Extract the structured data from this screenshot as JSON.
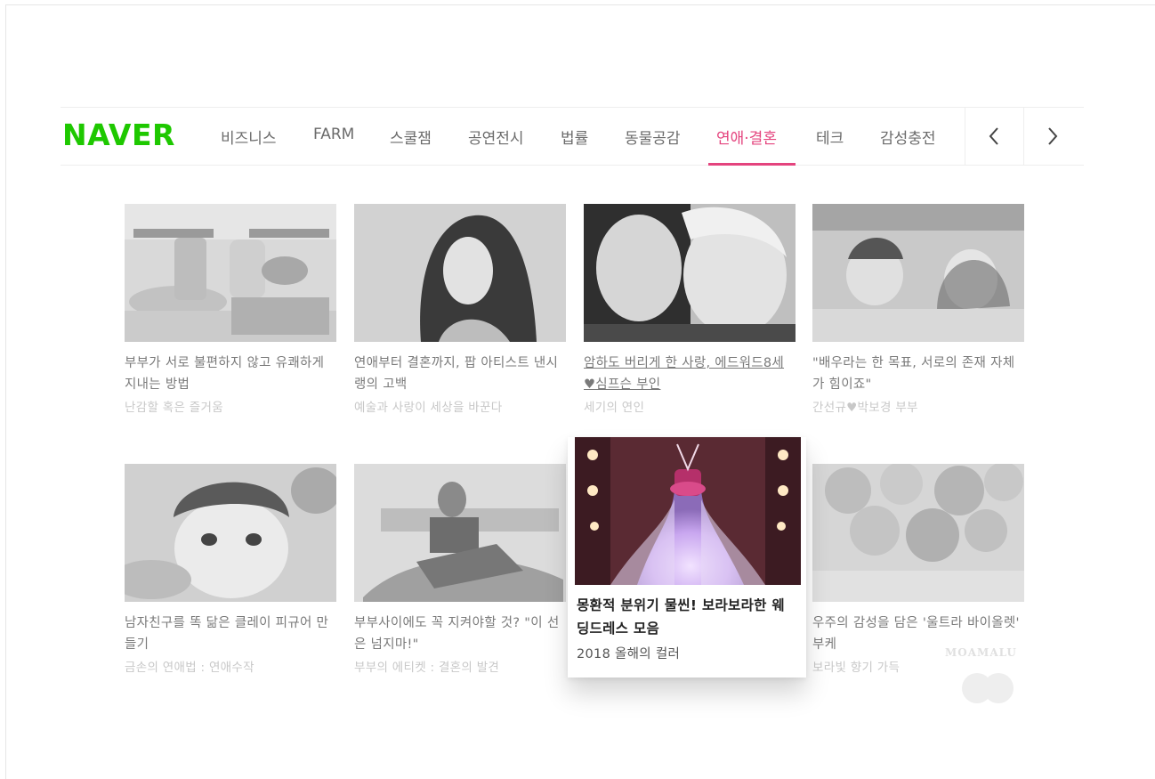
{
  "brand": {
    "logo": "NAVER",
    "color": "#1ec800",
    "accent": "#e4447e"
  },
  "nav": {
    "tabs": [
      {
        "label": "비즈니스",
        "active": false
      },
      {
        "label": "FARM",
        "active": false
      },
      {
        "label": "스쿨잼",
        "active": false
      },
      {
        "label": "공연전시",
        "active": false
      },
      {
        "label": "법률",
        "active": false
      },
      {
        "label": "동물공감",
        "active": false
      },
      {
        "label": "연애·결혼",
        "active": true
      },
      {
        "label": "테크",
        "active": false
      },
      {
        "label": "감성충전",
        "active": false
      }
    ],
    "prev_icon": "chevron-left-icon",
    "next_icon": "chevron-right-icon"
  },
  "cards": [
    {
      "title": "부부가 서로 불편하지 않고 유쾌하게 지내는 방법",
      "sub": "난감할 혹은 즐거움"
    },
    {
      "title": "연애부터 결혼까지, 팝 아티스트 낸시랭의 고백",
      "sub": "예술과 사랑이 세상을 바꾼다"
    },
    {
      "title": "암하도 버리게 한 사랑, 에드워드8세♥심프슨 부인",
      "sub": "세기의 연인"
    },
    {
      "title": "\"배우라는 한 목표, 서로의 존재 자체가 힘이죠\"",
      "sub": "간선규♥박보경 부부"
    },
    {
      "title": "남자친구를 똑 닮은 클레이 피규어 만들기",
      "sub": "금손의 연애법 : 연애수작"
    },
    {
      "title": "부부사이에도 꼭 지켜야할 것? \"이 선은 넘지마!\"",
      "sub": "부부의 에티켓 : 결혼의 발견"
    },
    {
      "title": "몽환적 분위기 물씬! 보라보라한 웨딩드레스 모음",
      "sub": "2018 올해의 컬러"
    },
    {
      "title": "우주의 감성을 담은 '울트라 바이올렛' 부케",
      "sub": "보라빛 향기 가득"
    }
  ],
  "watermark": "MOAMALU"
}
